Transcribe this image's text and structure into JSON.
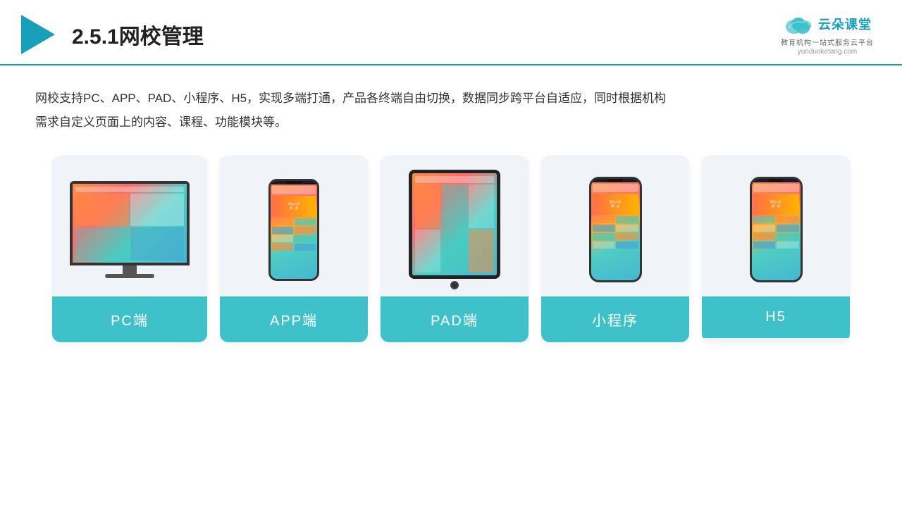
{
  "header": {
    "title": "2.5.1网校管理",
    "brand": {
      "name": "云朵课堂",
      "domain": "yunduoketang.com",
      "subtitle": "教育机构一站\n式服务云平台"
    }
  },
  "description": "网校支持PC、APP、PAD、小程序、H5，实现多端打通，产品各终端自由切换，数据同步跨平台自适应，同时根据机构\n需求自定义页面上的内容、课程、功能模块等。",
  "cards": [
    {
      "id": "pc",
      "label": "PC端"
    },
    {
      "id": "app",
      "label": "APP端"
    },
    {
      "id": "pad",
      "label": "PAD端"
    },
    {
      "id": "miniapp",
      "label": "小程序"
    },
    {
      "id": "h5",
      "label": "H5"
    }
  ],
  "colors": {
    "accent": "#3fc1c9",
    "border": "#1a9fba",
    "card_bg": "#eef2f7"
  }
}
